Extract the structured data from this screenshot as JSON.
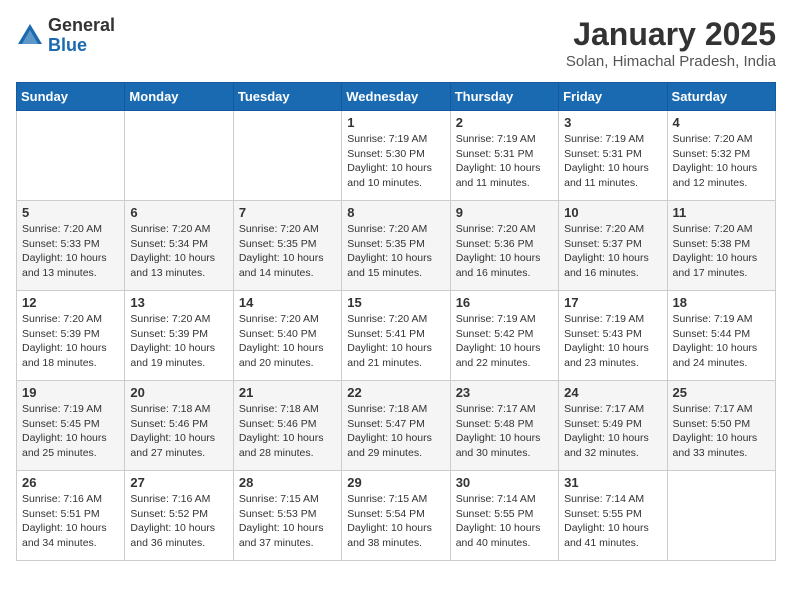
{
  "logo": {
    "general": "General",
    "blue": "Blue"
  },
  "title": "January 2025",
  "subtitle": "Solan, Himachal Pradesh, India",
  "days_of_week": [
    "Sunday",
    "Monday",
    "Tuesday",
    "Wednesday",
    "Thursday",
    "Friday",
    "Saturday"
  ],
  "weeks": [
    [
      {
        "day": "",
        "info": ""
      },
      {
        "day": "",
        "info": ""
      },
      {
        "day": "",
        "info": ""
      },
      {
        "day": "1",
        "info": "Sunrise: 7:19 AM\nSunset: 5:30 PM\nDaylight: 10 hours and 10 minutes."
      },
      {
        "day": "2",
        "info": "Sunrise: 7:19 AM\nSunset: 5:31 PM\nDaylight: 10 hours and 11 minutes."
      },
      {
        "day": "3",
        "info": "Sunrise: 7:19 AM\nSunset: 5:31 PM\nDaylight: 10 hours and 11 minutes."
      },
      {
        "day": "4",
        "info": "Sunrise: 7:20 AM\nSunset: 5:32 PM\nDaylight: 10 hours and 12 minutes."
      }
    ],
    [
      {
        "day": "5",
        "info": "Sunrise: 7:20 AM\nSunset: 5:33 PM\nDaylight: 10 hours and 13 minutes."
      },
      {
        "day": "6",
        "info": "Sunrise: 7:20 AM\nSunset: 5:34 PM\nDaylight: 10 hours and 13 minutes."
      },
      {
        "day": "7",
        "info": "Sunrise: 7:20 AM\nSunset: 5:35 PM\nDaylight: 10 hours and 14 minutes."
      },
      {
        "day": "8",
        "info": "Sunrise: 7:20 AM\nSunset: 5:35 PM\nDaylight: 10 hours and 15 minutes."
      },
      {
        "day": "9",
        "info": "Sunrise: 7:20 AM\nSunset: 5:36 PM\nDaylight: 10 hours and 16 minutes."
      },
      {
        "day": "10",
        "info": "Sunrise: 7:20 AM\nSunset: 5:37 PM\nDaylight: 10 hours and 16 minutes."
      },
      {
        "day": "11",
        "info": "Sunrise: 7:20 AM\nSunset: 5:38 PM\nDaylight: 10 hours and 17 minutes."
      }
    ],
    [
      {
        "day": "12",
        "info": "Sunrise: 7:20 AM\nSunset: 5:39 PM\nDaylight: 10 hours and 18 minutes."
      },
      {
        "day": "13",
        "info": "Sunrise: 7:20 AM\nSunset: 5:39 PM\nDaylight: 10 hours and 19 minutes."
      },
      {
        "day": "14",
        "info": "Sunrise: 7:20 AM\nSunset: 5:40 PM\nDaylight: 10 hours and 20 minutes."
      },
      {
        "day": "15",
        "info": "Sunrise: 7:20 AM\nSunset: 5:41 PM\nDaylight: 10 hours and 21 minutes."
      },
      {
        "day": "16",
        "info": "Sunrise: 7:19 AM\nSunset: 5:42 PM\nDaylight: 10 hours and 22 minutes."
      },
      {
        "day": "17",
        "info": "Sunrise: 7:19 AM\nSunset: 5:43 PM\nDaylight: 10 hours and 23 minutes."
      },
      {
        "day": "18",
        "info": "Sunrise: 7:19 AM\nSunset: 5:44 PM\nDaylight: 10 hours and 24 minutes."
      }
    ],
    [
      {
        "day": "19",
        "info": "Sunrise: 7:19 AM\nSunset: 5:45 PM\nDaylight: 10 hours and 25 minutes."
      },
      {
        "day": "20",
        "info": "Sunrise: 7:18 AM\nSunset: 5:46 PM\nDaylight: 10 hours and 27 minutes."
      },
      {
        "day": "21",
        "info": "Sunrise: 7:18 AM\nSunset: 5:46 PM\nDaylight: 10 hours and 28 minutes."
      },
      {
        "day": "22",
        "info": "Sunrise: 7:18 AM\nSunset: 5:47 PM\nDaylight: 10 hours and 29 minutes."
      },
      {
        "day": "23",
        "info": "Sunrise: 7:17 AM\nSunset: 5:48 PM\nDaylight: 10 hours and 30 minutes."
      },
      {
        "day": "24",
        "info": "Sunrise: 7:17 AM\nSunset: 5:49 PM\nDaylight: 10 hours and 32 minutes."
      },
      {
        "day": "25",
        "info": "Sunrise: 7:17 AM\nSunset: 5:50 PM\nDaylight: 10 hours and 33 minutes."
      }
    ],
    [
      {
        "day": "26",
        "info": "Sunrise: 7:16 AM\nSunset: 5:51 PM\nDaylight: 10 hours and 34 minutes."
      },
      {
        "day": "27",
        "info": "Sunrise: 7:16 AM\nSunset: 5:52 PM\nDaylight: 10 hours and 36 minutes."
      },
      {
        "day": "28",
        "info": "Sunrise: 7:15 AM\nSunset: 5:53 PM\nDaylight: 10 hours and 37 minutes."
      },
      {
        "day": "29",
        "info": "Sunrise: 7:15 AM\nSunset: 5:54 PM\nDaylight: 10 hours and 38 minutes."
      },
      {
        "day": "30",
        "info": "Sunrise: 7:14 AM\nSunset: 5:55 PM\nDaylight: 10 hours and 40 minutes."
      },
      {
        "day": "31",
        "info": "Sunrise: 7:14 AM\nSunset: 5:55 PM\nDaylight: 10 hours and 41 minutes."
      },
      {
        "day": "",
        "info": ""
      }
    ]
  ]
}
